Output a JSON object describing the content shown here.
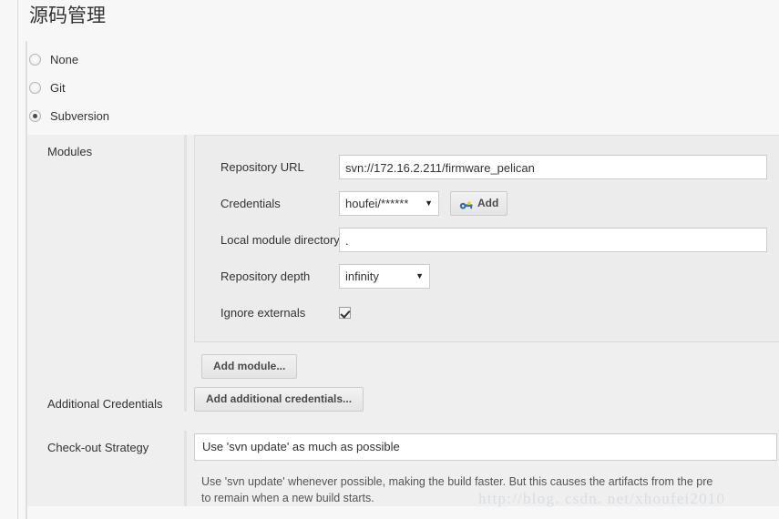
{
  "page": {
    "title": "源码管理",
    "watermark": "http://blog. csdn. net/xhoufei2010"
  },
  "scm_radios": [
    {
      "label": "None",
      "selected": false
    },
    {
      "label": "Git",
      "selected": false
    },
    {
      "label": "Subversion",
      "selected": true
    }
  ],
  "modules": {
    "section_label": "Modules",
    "repository_url": {
      "label": "Repository URL",
      "value": "svn://172.16.2.211/firmware_pelican"
    },
    "credentials": {
      "label": "Credentials",
      "value": "houfei/******",
      "caret": "▼",
      "add_button": "Add",
      "add_icon": "key-icon"
    },
    "local_module_directory": {
      "label": "Local module directory",
      "value": "."
    },
    "repository_depth": {
      "label": "Repository depth",
      "value": "infinity",
      "caret": "▼"
    },
    "ignore_externals": {
      "label": "Ignore externals",
      "checked": true
    },
    "add_module_button": "Add module..."
  },
  "additional_credentials": {
    "label": "Additional Credentials",
    "button": "Add additional credentials..."
  },
  "checkout_strategy": {
    "label": "Check-out Strategy",
    "value": "Use 'svn update' as much as possible",
    "help_line_1": "Use 'svn update' whenever possible, making the build faster. But this causes the artifacts from the pre",
    "help_line_2": "to remain when a new build starts."
  },
  "colors": {
    "page_bg": "#f7f7f7",
    "panel_bg": "#efefef",
    "module_bg": "#ececec",
    "border": "#dcdcdc",
    "text": "#333333",
    "watermark": "#d9dde4"
  }
}
